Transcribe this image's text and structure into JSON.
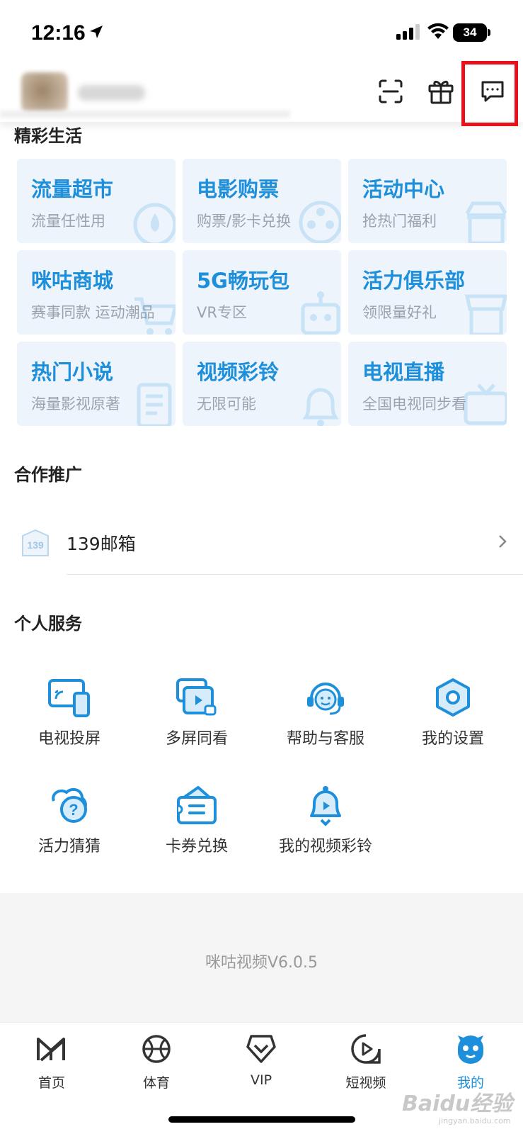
{
  "status_bar": {
    "time": "12:16",
    "battery": "34"
  },
  "header": {
    "icons": [
      "scan-icon",
      "gift-icon",
      "message-icon"
    ]
  },
  "sections": {
    "featured": "精彩生活",
    "partners": "合作推广",
    "services": "个人服务"
  },
  "tiles": [
    {
      "title": "流量超市",
      "sub": "流量任性用"
    },
    {
      "title": "电影购票",
      "sub": "购票/影卡兑换"
    },
    {
      "title": "活动中心",
      "sub": "抢热门福利"
    },
    {
      "title": "咪咕商城",
      "sub": "赛事同款 运动潮品"
    },
    {
      "title": "5G畅玩包",
      "sub": "VR专区"
    },
    {
      "title": "活力俱乐部",
      "sub": "领限量好礼"
    },
    {
      "title": "热门小说",
      "sub": "海量影视原著"
    },
    {
      "title": "视频彩铃",
      "sub": "无限可能"
    },
    {
      "title": "电视直播",
      "sub": "全国电视同步看"
    }
  ],
  "partner": {
    "label": "139邮箱",
    "icon_text": "139"
  },
  "services": [
    {
      "label": "电视投屏",
      "icon": "tv-cast-icon"
    },
    {
      "label": "多屏同看",
      "icon": "multi-screen-icon"
    },
    {
      "label": "帮助与客服",
      "icon": "customer-service-icon"
    },
    {
      "label": "我的设置",
      "icon": "settings-icon"
    },
    {
      "label": "活力猜猜",
      "icon": "quiz-icon"
    },
    {
      "label": "卡券兑换",
      "icon": "coupon-icon"
    },
    {
      "label": "我的视频彩铃",
      "icon": "video-ringtone-icon"
    }
  ],
  "version": "咪咕视频V6.0.5",
  "tabs": [
    {
      "label": "首页",
      "icon": "home-icon"
    },
    {
      "label": "体育",
      "icon": "sports-icon"
    },
    {
      "label": "VIP",
      "icon": "vip-icon"
    },
    {
      "label": "短视频",
      "icon": "short-video-icon"
    },
    {
      "label": "我的",
      "icon": "profile-icon",
      "active": true
    }
  ],
  "watermark": {
    "main": "Baidu经验",
    "sub": "jingyan.baidu.com"
  },
  "colors": {
    "accent": "#1d8fdb",
    "tile_bg": "#eef4fc",
    "highlight": "#e8101a"
  }
}
